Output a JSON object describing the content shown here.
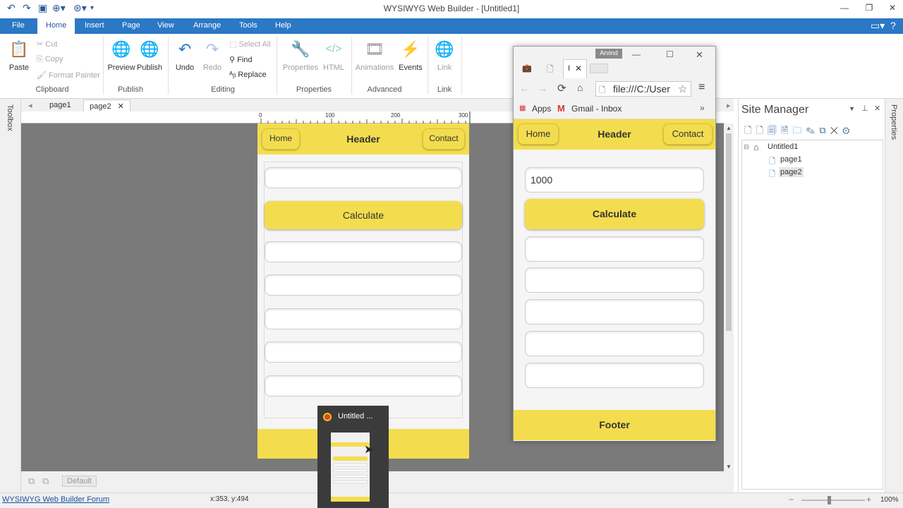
{
  "app": {
    "title": "WYSIWYG Web Builder - [Untitled1]"
  },
  "menu": {
    "items": [
      "File",
      "Home",
      "Insert",
      "Page",
      "View",
      "Arrange",
      "Tools",
      "Help"
    ],
    "active": "Home"
  },
  "ribbon": {
    "clipboard": {
      "paste": "Paste",
      "cut": "Cut",
      "copy": "Copy",
      "format_painter": "Format Painter",
      "label": "Clipboard"
    },
    "publish": {
      "preview": "Preview",
      "publish": "Publish",
      "label": "Publish"
    },
    "editing": {
      "undo": "Undo",
      "redo": "Redo",
      "select_all": "Select All",
      "find": "Find",
      "replace": "Replace",
      "label": "Editing"
    },
    "properties": {
      "properties": "Properties",
      "html": "HTML",
      "label": "Properties"
    },
    "advanced": {
      "animations": "Animations",
      "events": "Events",
      "label": "Advanced"
    },
    "link": {
      "link": "Link",
      "label": "Link"
    }
  },
  "page_tabs": [
    "page1",
    "page2"
  ],
  "active_page_tab": "page2",
  "toolbox_label": "Toolbox",
  "properties_label": "Properties",
  "ruler": {
    "marks": [
      "0",
      "100",
      "200",
      "300"
    ]
  },
  "design_page": {
    "nav_home": "Home",
    "header": "Header",
    "nav_contact": "Contact",
    "calculate": "Calculate"
  },
  "browser": {
    "user_badge": "Arvind",
    "tab_label": "I",
    "address": "file:///C:/User",
    "bookmarks": {
      "apps": "Apps",
      "gmail": "Gmail - Inbox"
    },
    "nav_home": "Home",
    "header": "Header",
    "nav_contact": "Contact",
    "input_value": "1000",
    "calculate": "Calculate",
    "footer": "Footer"
  },
  "site_manager": {
    "title": "Site Manager",
    "tree": {
      "root": "Untitled1",
      "pages": [
        "page1",
        "page2"
      ]
    }
  },
  "bottom": {
    "default_label": "Default"
  },
  "status": {
    "forum_link": "WYSIWYG Web Builder Forum",
    "coords": "x:353, y:494",
    "zoom": "100%"
  },
  "taskbar_thumb": {
    "title": "Untitled ..."
  },
  "colors": {
    "accent": "#2b78c5",
    "theme_yellow": "#f3dd4f",
    "canvas_gray": "#7a7a7a"
  }
}
